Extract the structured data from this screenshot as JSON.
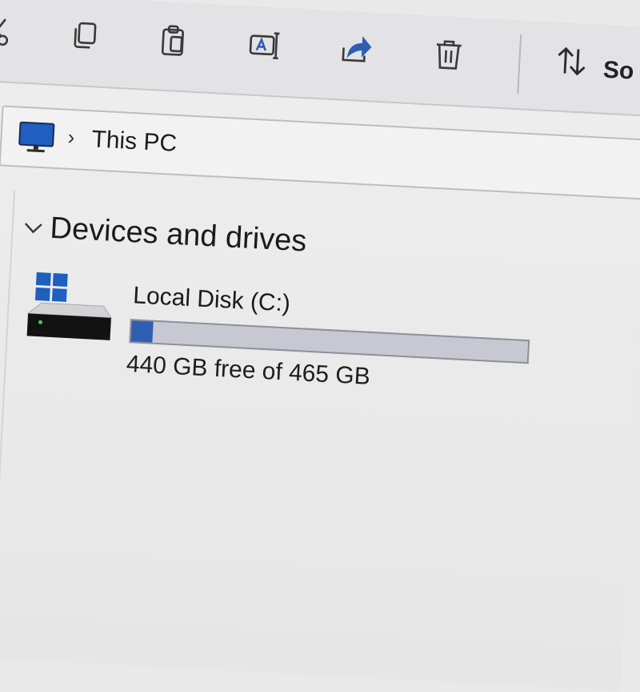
{
  "toolbar": {
    "buttons": [
      {
        "name": "cut",
        "icon": "scissors-icon"
      },
      {
        "name": "copy",
        "icon": "copy-icon"
      },
      {
        "name": "paste",
        "icon": "paste-icon"
      },
      {
        "name": "rename",
        "icon": "rename-icon"
      },
      {
        "name": "share",
        "icon": "share-icon"
      },
      {
        "name": "delete",
        "icon": "trash-icon"
      }
    ],
    "sort_icon": "sort-arrows-icon",
    "sort_label_partial": "So"
  },
  "address": {
    "icon": "monitor-icon",
    "crumbs": [
      "This PC"
    ]
  },
  "group": {
    "title": "Devices and drives",
    "drives": [
      {
        "name": "Local Disk (C:)",
        "free_text": "440 GB free of 465 GB",
        "used_fraction": 0.054,
        "icon": "windows-drive-icon"
      }
    ]
  },
  "colors": {
    "accent_blue": "#2f5fb3",
    "bar_track": "#c7c8d2",
    "icon_stroke": "#3a3a3a",
    "windows_blue": "#1e5fbf"
  }
}
